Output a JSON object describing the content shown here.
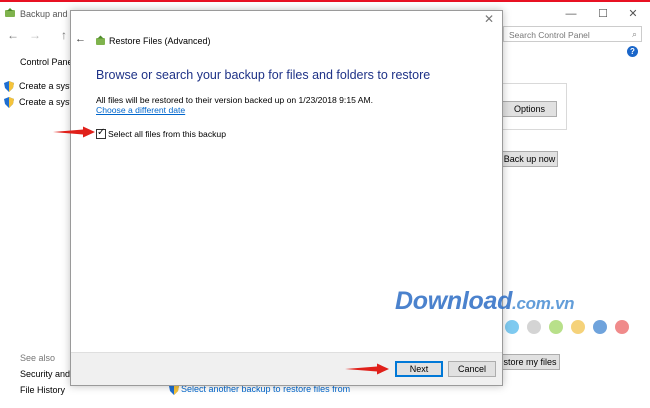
{
  "background_window": {
    "title": "Backup and R",
    "search_placeholder": "Search Control Panel",
    "control_panel_home": "Control Panel",
    "sidebar_items": [
      {
        "label": "Create a syste"
      },
      {
        "label": "Create a syste"
      }
    ],
    "see_also": "See also",
    "security_link": "Security and M",
    "file_history_link": "File History",
    "options_button": "Options",
    "backup_now_button": "Back up now",
    "restore_my_files_button": "store my files",
    "select_another_backup_link": "Select another backup to restore files from",
    "caption": {
      "minimize": "—",
      "maximize": "☐",
      "close": "✕"
    },
    "accent_color": "#e81123"
  },
  "dialog": {
    "title": "Restore Files (Advanced)",
    "heading": "Browse or search your backup for files and folders to restore",
    "info_text": "All files will be restored to their version backed up on 1/23/2018 9:15 AM.",
    "choose_date_link": "Choose a different date",
    "checkbox_label": "Select all files from this backup",
    "checkbox_checked": true,
    "next_button": "Next",
    "cancel_button": "Cancel",
    "heading_color": "#1e3287",
    "link_color": "#0066cc"
  },
  "watermark": {
    "main": "Download",
    "suffix": ".com.vn"
  },
  "decor": {
    "dot_colors": [
      "#7fcaf0",
      "#d4d4d4",
      "#b8e08a",
      "#f5d27a",
      "#6fa3dc",
      "#f08b8b"
    ],
    "arrow_color": "#e0201a"
  }
}
